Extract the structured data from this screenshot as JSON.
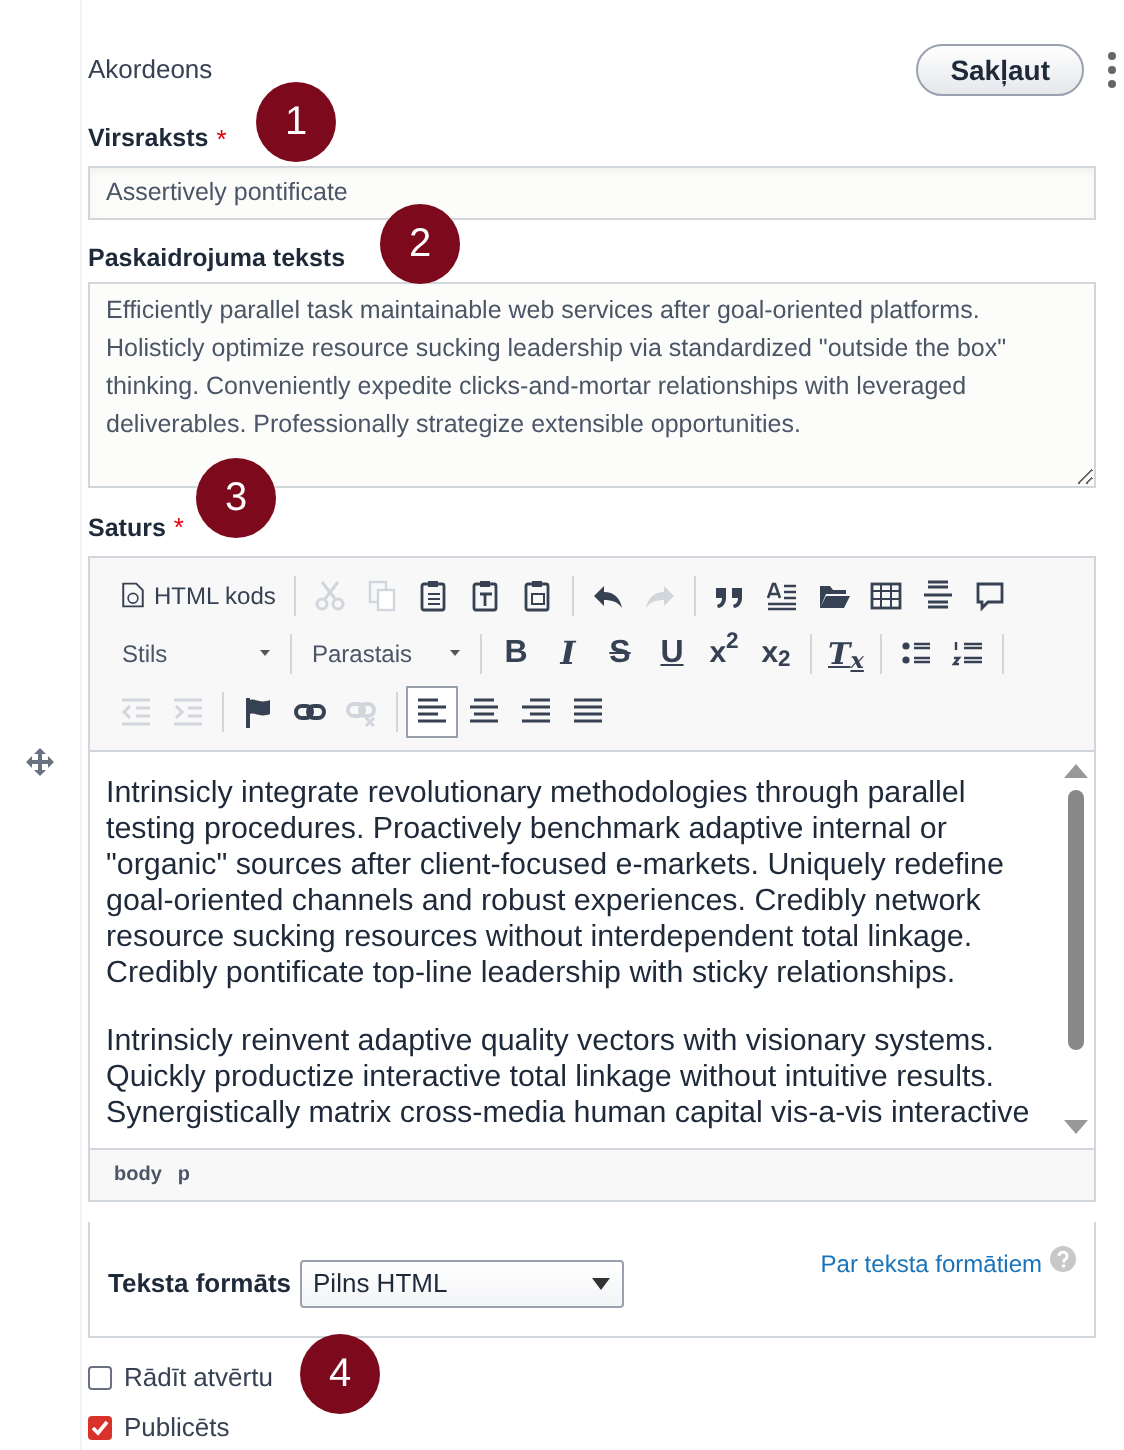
{
  "paragraph": {
    "type_label": "Akordeons",
    "collapse_button": "Sakļaut"
  },
  "fields": [
    {
      "kind": "input",
      "label": "Virsraksts",
      "required_mark": "*",
      "value": "Assertively pontificate"
    },
    {
      "kind": "textarea",
      "label": "Paskaidrojuma teksts",
      "value": "Efficiently parallel task maintainable web services after goal-oriented platforms. Holisticly optimize resource sucking leadership via standardized \"outside the box\" thinking. Conveniently expedite clicks-and-mortar relationships with leveraged deliverables. Professionally strategize extensible opportunities."
    },
    {
      "kind": "editor",
      "label": "Saturs",
      "required_mark": "*"
    }
  ],
  "editor": {
    "toolbar_rows": [
      [
        {
          "kind": "source",
          "label": "HTML kods",
          "disabled": false
        },
        {
          "kind": "sep"
        },
        {
          "kind": "cut",
          "disabled": true
        },
        {
          "kind": "copy",
          "disabled": true
        },
        {
          "kind": "paste",
          "disabled": false
        },
        {
          "kind": "paste-text",
          "disabled": false
        },
        {
          "kind": "paste-word",
          "disabled": false
        },
        {
          "kind": "sep"
        },
        {
          "kind": "undo",
          "disabled": false
        },
        {
          "kind": "redo",
          "disabled": true
        },
        {
          "kind": "sep"
        },
        {
          "kind": "blockquote",
          "disabled": false
        },
        {
          "kind": "styles-list",
          "disabled": false
        },
        {
          "kind": "folder",
          "disabled": false
        },
        {
          "kind": "table",
          "disabled": false
        },
        {
          "kind": "hr",
          "disabled": false
        },
        {
          "kind": "comment",
          "disabled": false
        }
      ],
      [
        {
          "kind": "dropdown",
          "label": "Stils",
          "disabled": false
        },
        {
          "kind": "sep"
        },
        {
          "kind": "dropdown",
          "label": "Parastais",
          "disabled": false
        },
        {
          "kind": "sep"
        },
        {
          "kind": "bold",
          "label": "B",
          "disabled": false
        },
        {
          "kind": "italic",
          "label": "I",
          "disabled": false
        },
        {
          "kind": "strike",
          "label": "S",
          "disabled": false
        },
        {
          "kind": "underline",
          "label": "U",
          "disabled": false
        },
        {
          "kind": "superscript",
          "label": "x$^{2}$",
          "disabled": false
        },
        {
          "kind": "subscript",
          "label": "x$_{2}$",
          "disabled": false
        },
        {
          "kind": "sep"
        },
        {
          "kind": "remove-format",
          "label": "T$_{x}$",
          "disabled": false
        },
        {
          "kind": "sep"
        },
        {
          "kind": "bullets",
          "disabled": false
        },
        {
          "kind": "numbers",
          "disabled": false
        },
        {
          "kind": "sep"
        }
      ],
      [
        {
          "kind": "outdent",
          "disabled": true
        },
        {
          "kind": "indent",
          "disabled": true
        },
        {
          "kind": "sep"
        },
        {
          "kind": "anchor",
          "disabled": false
        },
        {
          "kind": "link",
          "disabled": false
        },
        {
          "kind": "unlink",
          "disabled": true
        },
        {
          "kind": "sep"
        },
        {
          "kind": "align-left",
          "disabled": false,
          "selected": true
        },
        {
          "kind": "align-center",
          "disabled": false,
          "selected": false
        },
        {
          "kind": "align-right",
          "disabled": false,
          "selected": false
        },
        {
          "kind": "justify",
          "disabled": false,
          "selected": false
        }
      ]
    ],
    "paragraphs": [
      "Intrinsicly integrate revolutionary methodologies through parallel testing procedures. Proactively benchmark adaptive internal or \"organic\" sources after client-focused e-markets. Uniquely redefine goal-oriented channels and robust experiences. Credibly network resource sucking resources without interdependent total linkage. Credibly pontificate top-line leadership with sticky relationships.",
      "Intrinsicly reinvent adaptive quality vectors with visionary systems. Quickly productize interactive total linkage without intuitive results. Synergistically matrix cross-media human capital vis-a-vis interactive"
    ],
    "path": [
      "body",
      "p"
    ]
  },
  "text_format": {
    "label": "Teksta formāts",
    "value": "Pilns HTML",
    "help_link": "Par teksta formātiem"
  },
  "checkboxes": [
    {
      "label": "Rādīt atvērtu",
      "checked": false
    },
    {
      "label": "Publicēts",
      "checked": true
    }
  ],
  "annotations": [
    "1",
    "2",
    "3",
    "4"
  ]
}
